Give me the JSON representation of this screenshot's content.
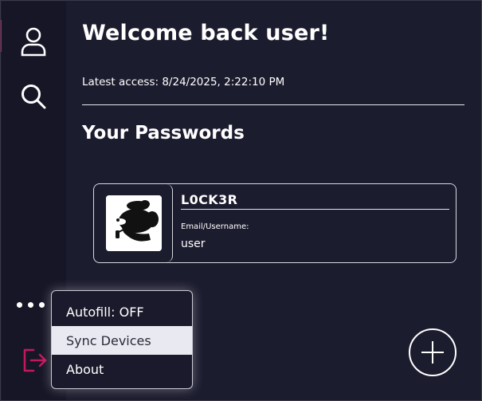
{
  "main": {
    "welcome": "Welcome back user!",
    "latest_access": "Latest access: 8/24/2025, 2:22:10 PM",
    "section_title": "Your Passwords"
  },
  "card": {
    "title": "L0CK3R",
    "label": "Email/Username:",
    "username": "user"
  },
  "sidebar": {
    "icons": [
      "user-icon",
      "search-icon",
      "more-dots-icon",
      "logout-icon"
    ]
  },
  "menu": {
    "items": [
      {
        "label": "Autofill: OFF"
      },
      {
        "label": "Sync Devices",
        "active": true
      },
      {
        "label": "About"
      }
    ]
  },
  "colors": {
    "background": "#1c1c2f",
    "sidebar": "#161627",
    "accent": "#c2185b",
    "text": "#ffffff",
    "menu_active_bg": "#e9e9f1"
  }
}
